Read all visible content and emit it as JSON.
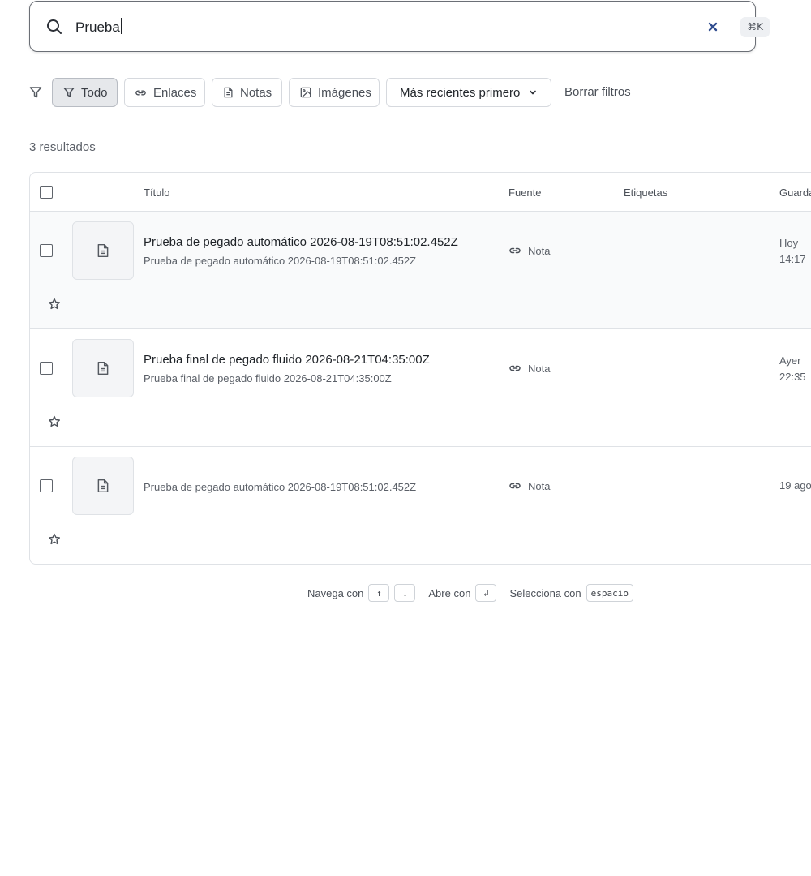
{
  "search": {
    "value": "Prueba",
    "shortcut": "⌘K",
    "icons": {
      "search": "search-icon",
      "clear": "close-icon"
    },
    "clear_color": "#2f4c8f"
  },
  "filters": {
    "chips": [
      {
        "label": "Todo",
        "icon": "filter-icon",
        "active": true
      },
      {
        "label": "Enlaces",
        "icon": "link-icon",
        "active": false
      },
      {
        "label": "Notas",
        "icon": "note-icon",
        "active": false
      },
      {
        "label": "Imágenes",
        "icon": "image-icon",
        "active": false
      }
    ],
    "sort_label": "Más recientes primero",
    "clear_label": "Borrar filtros"
  },
  "results_count": "3 resultados",
  "table": {
    "headers": {
      "title": "Título",
      "source": "Fuente",
      "tags": "Etiquetas",
      "saved": "Guarda"
    },
    "rows": [
      {
        "title": "Prueba de pegado automático 2026-08-19T08:51:02.452Z",
        "subtitle": "Prueba de pegado automático 2026-08-19T08:51:02.452Z",
        "source": "Nota",
        "saved_line1": "Hoy",
        "saved_line2": "14:17"
      },
      {
        "title": "Prueba final de pegado fluido 2026-08-21T04:35:00Z",
        "subtitle": "Prueba final de pegado fluido 2026-08-21T04:35:00Z",
        "source": "Nota",
        "saved_line1": "Ayer",
        "saved_line2": "22:35"
      },
      {
        "title": "",
        "subtitle": "Prueba de pegado automático 2026-08-19T08:51:02.452Z",
        "source": "Nota",
        "saved_line1": "19 ago",
        "saved_line2": ""
      }
    ]
  },
  "hints": {
    "navigate": "Navega con",
    "up_key": "↑",
    "down_key": "↓",
    "open": "Abre con",
    "enter_key": "↲",
    "select": "Selecciona con",
    "space_key": "espacio"
  }
}
